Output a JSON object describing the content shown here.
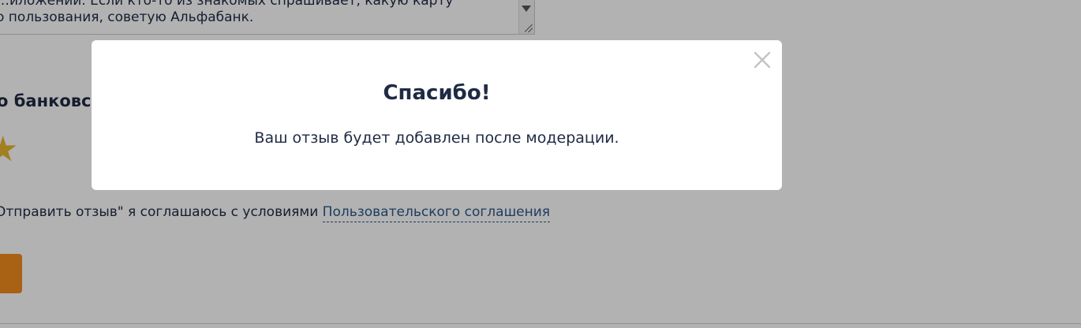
{
  "review_form": {
    "textarea_value": "…иложении. Если кто-то из знакомых спрашивает, какую карту\nо пользования, советую Альфабанк.",
    "section_heading": "о банковск",
    "agreement_text": "Отправить отзыв\" я соглашаюсь с условиями ",
    "agreement_link": "Пользовательского соглашения",
    "rating_icon": "star-icon",
    "star_color": "#e8b630",
    "submit_color": "#f28c1e"
  },
  "modal": {
    "title": "Спасибо!",
    "message": "Ваш отзыв будет добавлен после модерации.",
    "close_icon": "close-icon"
  }
}
